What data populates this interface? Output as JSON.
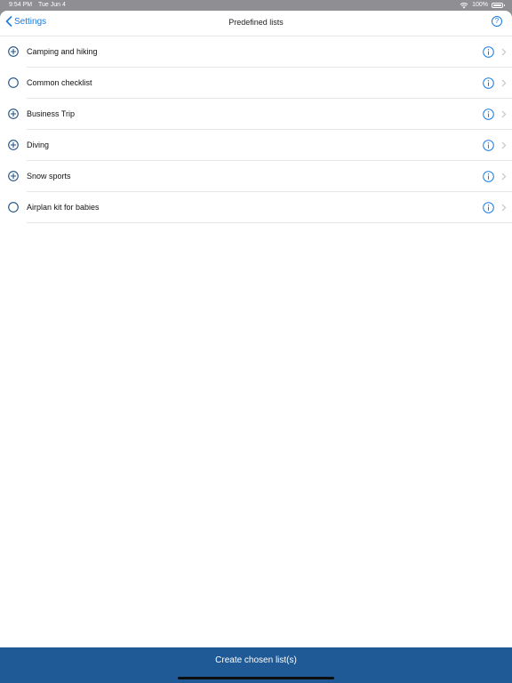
{
  "status_bar": {
    "time": "9:54 PM",
    "date": "Tue Jun 4",
    "battery": "100%"
  },
  "nav": {
    "back_label": "Settings",
    "title": "Predefined lists",
    "help_glyph": "?"
  },
  "lists": [
    {
      "label": "Camping and hiking",
      "state": "plus"
    },
    {
      "label": "Common checklist",
      "state": "empty"
    },
    {
      "label": "Business Trip",
      "state": "plus"
    },
    {
      "label": "Diving",
      "state": "plus"
    },
    {
      "label": "Snow sports",
      "state": "plus"
    },
    {
      "label": "Airplan kit for babies",
      "state": "empty"
    }
  ],
  "footer": {
    "create_label": "Create chosen list(s)"
  },
  "colors": {
    "accent": "#1a7ae0",
    "footer_bg": "#1f5a96",
    "selector": "#1f4f86"
  },
  "icons": {
    "selector_plus": "plus-circle-icon",
    "selector_empty": "empty-circle-icon",
    "info": "info-circle-icon",
    "chevron": "chevron-right-icon"
  }
}
